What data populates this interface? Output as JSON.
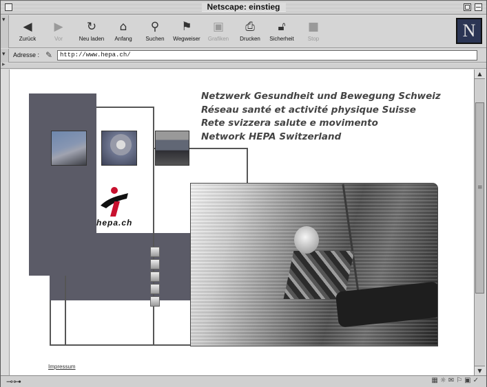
{
  "window": {
    "title": "Netscape: einstieg"
  },
  "toolbar": {
    "buttons": [
      {
        "label": "Zurück",
        "icon": "back-arrow-icon",
        "enabled": true
      },
      {
        "label": "Vor",
        "icon": "forward-arrow-icon",
        "enabled": false
      },
      {
        "label": "Neu laden",
        "icon": "reload-icon",
        "enabled": true
      },
      {
        "label": "Anfang",
        "icon": "home-icon",
        "enabled": true
      },
      {
        "label": "Suchen",
        "icon": "search-icon",
        "enabled": true
      },
      {
        "label": "Wegweiser",
        "icon": "guide-icon",
        "enabled": true
      },
      {
        "label": "Grafiken",
        "icon": "images-icon",
        "enabled": false
      },
      {
        "label": "Drucken",
        "icon": "print-icon",
        "enabled": true
      },
      {
        "label": "Sicherheit",
        "icon": "lock-icon",
        "enabled": true
      },
      {
        "label": "Stop",
        "icon": "stop-icon",
        "enabled": false
      }
    ],
    "logo_letter": "N"
  },
  "address": {
    "label": "Adresse :",
    "value": "http://www.hepa.ch/"
  },
  "page": {
    "headlines": [
      "Netzwerk Gesundheit und Bewegung Schweiz",
      "Réseau santé et activité physique Suisse",
      "Rete svizzera salute e movimento",
      "Network HEPA Switzerland"
    ],
    "logo_text": "hepa.ch",
    "impressum": "Impressum"
  },
  "colors": {
    "dark_panel": "#5b5b67",
    "headline_text": "#444444"
  }
}
